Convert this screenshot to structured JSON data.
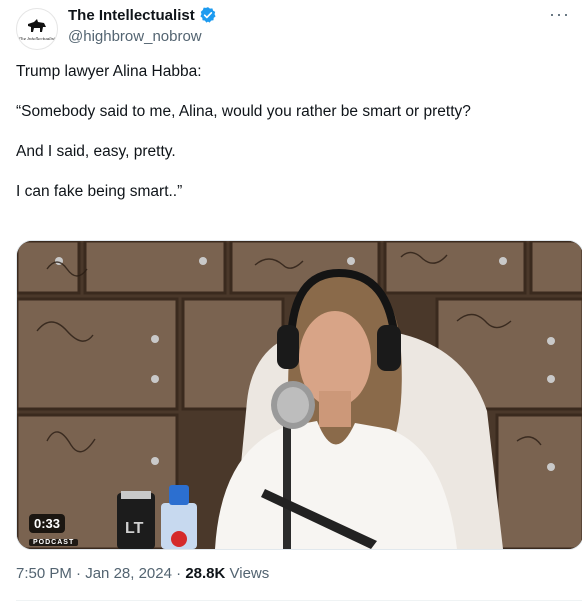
{
  "author": {
    "name": "The Intellectualist",
    "handle": "@highbrow_nobrow",
    "avatar_icon": "man-on-horseback-logo",
    "avatar_text": "The Intellectualist",
    "verified_color": "#1d9bf0"
  },
  "menu": {
    "more_label": "···"
  },
  "tweet": {
    "lines": [
      "Trump lawyer Alina Habba:",
      "“Somebody said to me, Alina, would you rather be smart or pretty?",
      "And I said, easy, pretty.",
      "I can fake being smart..”"
    ]
  },
  "media": {
    "duration": "0:33",
    "badge": "PODCAST",
    "water_label": "LT"
  },
  "meta": {
    "time": "7:50 PM",
    "sep1": " · ",
    "date": "Jan 28, 2024",
    "sep2": " · ",
    "views_count": "28.8K",
    "views_label": " Views"
  }
}
